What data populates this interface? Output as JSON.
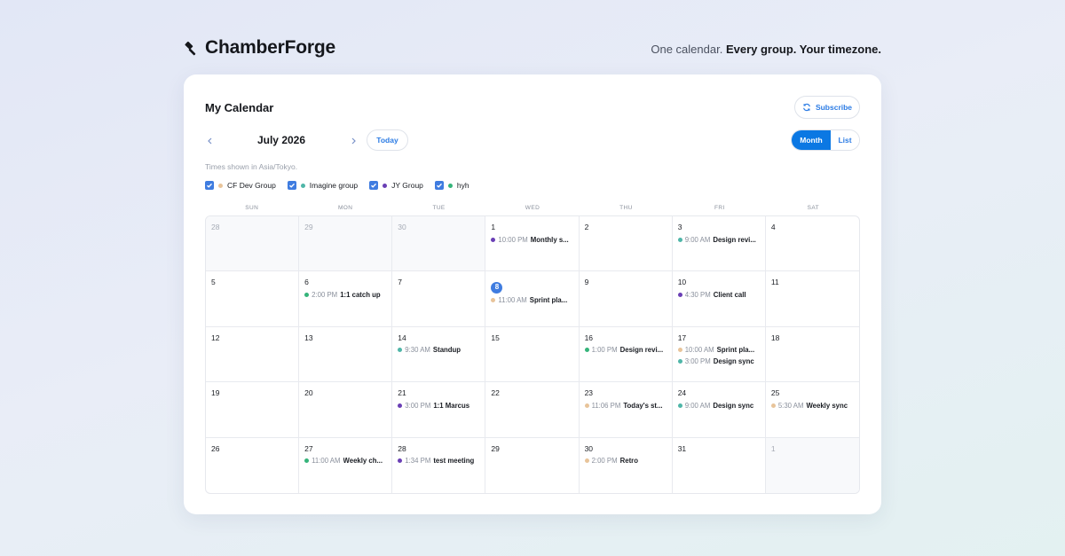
{
  "brand": {
    "name": "ChamberForge",
    "logo_icon": "gavel-icon"
  },
  "tagline": {
    "lead": "One calendar.",
    "bold": "Every group. Your timezone."
  },
  "calendar": {
    "title": "My Calendar",
    "subscribe_label": "Subscribe",
    "month_label": "July 2026",
    "today_label": "Today",
    "view_month_label": "Month",
    "view_list_label": "List",
    "tz_note": "Times shown in Asia/Tokyo.",
    "filters": [
      {
        "label": "CF Dev Group",
        "color": "#e8c49a",
        "checked": true
      },
      {
        "label": "Imagine group",
        "color": "#4fb6a8",
        "checked": true
      },
      {
        "label": "JY Group",
        "color": "#6a3fb5",
        "checked": true
      },
      {
        "label": "hyh",
        "color": "#35b47a",
        "checked": true
      }
    ],
    "weekdays": [
      "SUN",
      "MON",
      "TUE",
      "WED",
      "THU",
      "FRI",
      "SAT"
    ],
    "weeks": [
      [
        {
          "day": "28",
          "muted": true,
          "events": []
        },
        {
          "day": "29",
          "muted": true,
          "events": []
        },
        {
          "day": "30",
          "muted": true,
          "events": []
        },
        {
          "day": "1",
          "events": [
            {
              "time": "10:00 PM",
              "title": "Monthly s...",
              "color": "#6a3fb5"
            }
          ]
        },
        {
          "day": "2",
          "events": []
        },
        {
          "day": "3",
          "events": [
            {
              "time": "9:00 AM",
              "title": "Design revi...",
              "color": "#4fb6a8"
            }
          ]
        },
        {
          "day": "4",
          "events": []
        }
      ],
      [
        {
          "day": "5",
          "events": []
        },
        {
          "day": "6",
          "events": [
            {
              "time": "2:00 PM",
              "title": "1:1 catch up",
              "color": "#35b47a"
            }
          ]
        },
        {
          "day": "7",
          "events": []
        },
        {
          "day": "8",
          "today": true,
          "events": [
            {
              "time": "11:00 AM",
              "title": "Sprint pla...",
              "color": "#e8c49a"
            }
          ]
        },
        {
          "day": "9",
          "events": []
        },
        {
          "day": "10",
          "events": [
            {
              "time": "4:30 PM",
              "title": "Client call",
              "color": "#6a3fb5"
            }
          ]
        },
        {
          "day": "11",
          "events": []
        }
      ],
      [
        {
          "day": "12",
          "events": []
        },
        {
          "day": "13",
          "events": []
        },
        {
          "day": "14",
          "events": [
            {
              "time": "9:30 AM",
              "title": "Standup",
              "color": "#4fb6a8"
            }
          ]
        },
        {
          "day": "15",
          "events": []
        },
        {
          "day": "16",
          "events": [
            {
              "time": "1:00 PM",
              "title": "Design revi...",
              "color": "#35b47a"
            }
          ]
        },
        {
          "day": "17",
          "events": [
            {
              "time": "10:00 AM",
              "title": "Sprint pla...",
              "color": "#e8c49a"
            },
            {
              "time": "3:00 PM",
              "title": "Design sync",
              "color": "#4fb6a8"
            }
          ]
        },
        {
          "day": "18",
          "events": []
        }
      ],
      [
        {
          "day": "19",
          "events": []
        },
        {
          "day": "20",
          "events": []
        },
        {
          "day": "21",
          "events": [
            {
              "time": "3:00 PM",
              "title": "1:1 Marcus",
              "color": "#6a3fb5"
            }
          ]
        },
        {
          "day": "22",
          "events": []
        },
        {
          "day": "23",
          "events": [
            {
              "time": "11:06 PM",
              "title": "Today's st...",
              "color": "#e8c49a"
            }
          ]
        },
        {
          "day": "24",
          "events": [
            {
              "time": "9:00 AM",
              "title": "Design sync",
              "color": "#4fb6a8"
            }
          ]
        },
        {
          "day": "25",
          "events": [
            {
              "time": "5:30 AM",
              "title": "Weekly sync",
              "color": "#e8c49a"
            }
          ]
        }
      ],
      [
        {
          "day": "26",
          "events": []
        },
        {
          "day": "27",
          "events": [
            {
              "time": "11:00 AM",
              "title": "Weekly ch...",
              "color": "#35b47a"
            }
          ]
        },
        {
          "day": "28",
          "events": [
            {
              "time": "1:34 PM",
              "title": "test meeting",
              "color": "#6a3fb5"
            }
          ]
        },
        {
          "day": "29",
          "events": []
        },
        {
          "day": "30",
          "events": [
            {
              "time": "2:00 PM",
              "title": "Retro",
              "color": "#e8c49a"
            }
          ]
        },
        {
          "day": "31",
          "events": []
        },
        {
          "day": "1",
          "muted": true,
          "events": []
        }
      ]
    ]
  }
}
